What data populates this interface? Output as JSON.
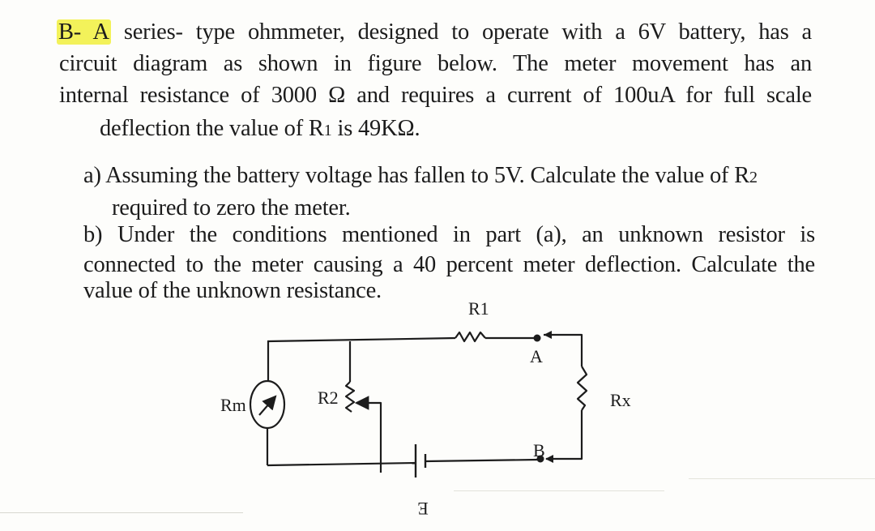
{
  "problem": {
    "label": "B- A",
    "line1_rest": "series- type ohmmeter, designed to operate with a 6V battery, has a",
    "line2": "circuit diagram as shown in figure below. The meter movement has an",
    "line3": "internal resistance of 3000 Ω and requires a current of 100uA for full scale",
    "line4_pre": "deflection the value of R",
    "line4_sub": "1",
    "line4_post": " is 49KΩ.",
    "highlight_color": "#f3f25a"
  },
  "part_a": {
    "line1_pre": "a) Assuming the battery voltage has fallen to 5V. Calculate the value of R",
    "line1_sub": "2",
    "line2": "required to zero the meter."
  },
  "part_b": {
    "line1": "b) Under the conditions mentioned in part (a), an unknown resistor is",
    "line2": "connected to the meter causing a 40 percent meter deflection. Calculate the",
    "line3": "value of the unknown resistance."
  },
  "circuit": {
    "labels": {
      "r1": "R1",
      "r2": "R2",
      "rm": "Rm",
      "rx": "Rx",
      "terminal_a": "A",
      "terminal_b": "B",
      "battery": "E"
    }
  }
}
